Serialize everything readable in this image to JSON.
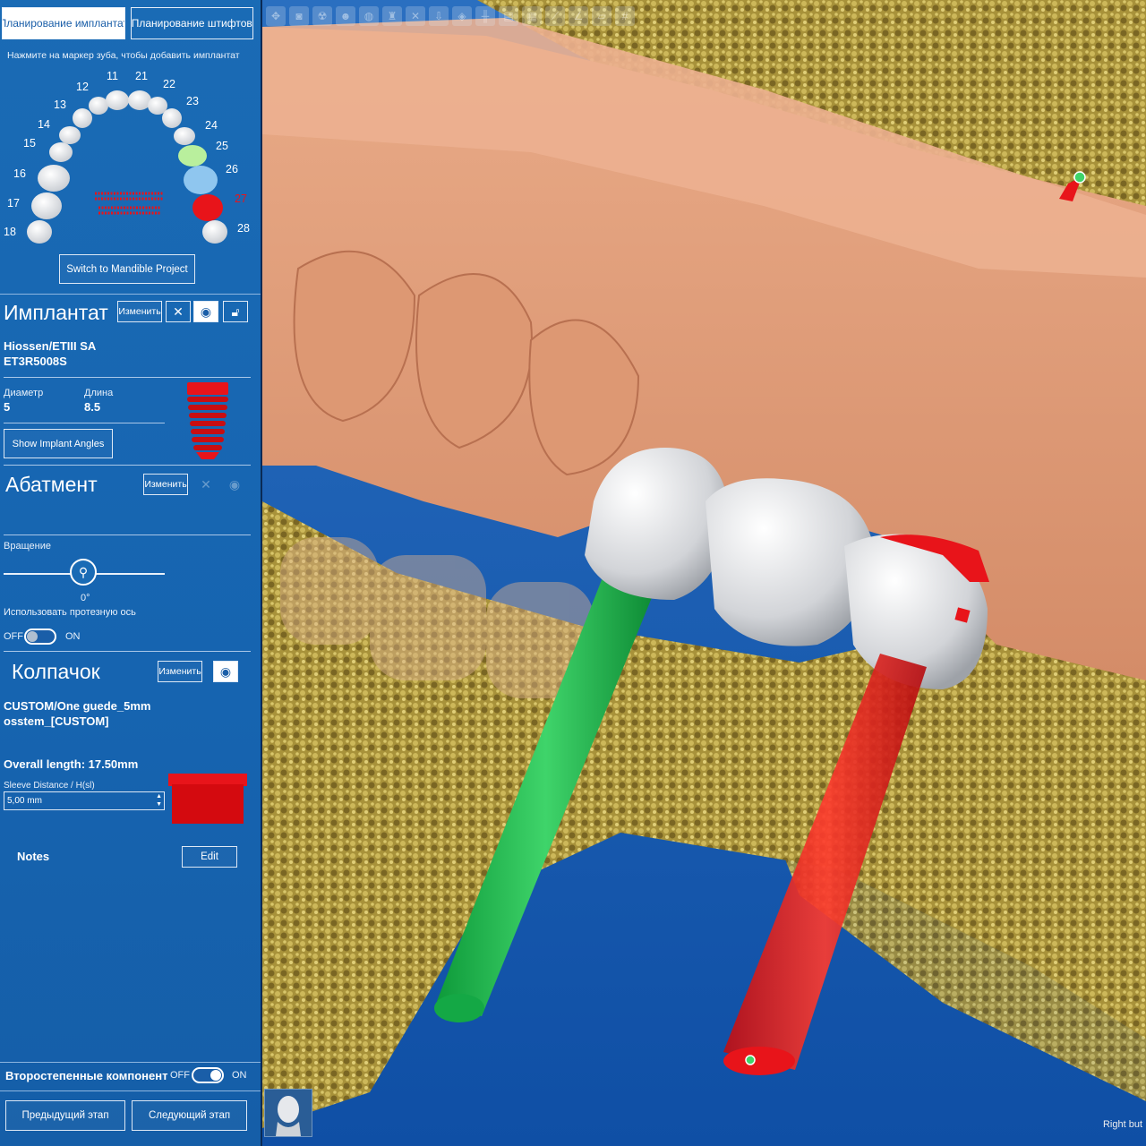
{
  "tabs": [
    {
      "label": "Планирование имплантат",
      "active": true
    },
    {
      "label": "Планирование штифтов",
      "active": false
    }
  ],
  "hint": "Нажмите на маркер зуба, чтобы добавить имплантат",
  "tooth_chart": {
    "numbers": [
      "11",
      "12",
      "13",
      "14",
      "15",
      "16",
      "17",
      "18",
      "21",
      "22",
      "23",
      "24",
      "25",
      "26",
      "27",
      "28"
    ],
    "highlighted": {
      "25": "green",
      "26": "light-blue",
      "27": "red"
    }
  },
  "switch_button": "Switch to Mandible Project",
  "implant": {
    "title": "Имплантат",
    "change_label": "Изменить",
    "name_line1": "Hiossen/ETIII SA",
    "name_line2": "ET3R5008S",
    "diameter_label": "Диаметр",
    "diameter": "5",
    "length_label": "Длина",
    "length": "8.5",
    "angles_button": "Show Implant Angles"
  },
  "abutment": {
    "title": "Абатмент",
    "change_label": "Изменить",
    "rotation_label": "Вращение",
    "rotation_value": "0°",
    "prosthetic_axis_label": "Использовать протезную ось",
    "off": "OFF",
    "on": "ON"
  },
  "sleeve": {
    "title": "Колпачок",
    "change_label": "Изменить",
    "name_line1": "CUSTOM/One guede_5mm",
    "name_line2": "osstem_[CUSTOM]",
    "overall_length": "Overall length: 17.50mm",
    "distance_label": "Sleeve Distance / H(sl)",
    "distance_value": "5,00 mm"
  },
  "notes": {
    "label": "Notes",
    "edit": "Edit"
  },
  "secondary": {
    "label": "Второстепенные компонент",
    "off": "OFF",
    "on": "ON"
  },
  "nav": {
    "prev": "Предыдущий этап",
    "next": "Следующий этап"
  },
  "viewport": {
    "corner_text": "Right but"
  },
  "colors": {
    "panel": "#1a6bb5",
    "implant_red": "#e8141a",
    "implant_green": "#17b24a",
    "gum": "#e0a07f",
    "bone": "#b8a040"
  }
}
